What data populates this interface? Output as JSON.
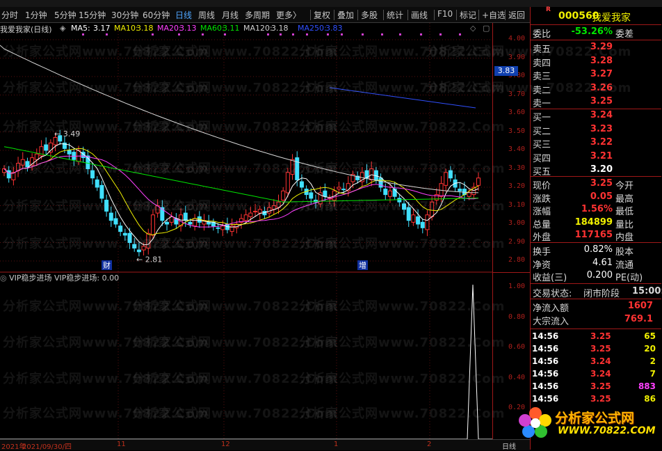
{
  "toolbar": {
    "left": [
      "分时",
      "1分钟",
      "5分钟",
      "15分钟",
      "30分钟",
      "60分钟",
      "日线",
      "周线",
      "月线",
      "多周期",
      "更多〉"
    ],
    "right": [
      "复权",
      "叠加",
      "多股",
      "统计",
      "画线",
      "F10",
      "标记",
      "+自选",
      "返回"
    ],
    "active": "日线"
  },
  "chart": {
    "stock_label": "我爱我家(日线)",
    "ma": [
      {
        "name": "MA5:",
        "value": "3.17",
        "color": "#ffffff"
      },
      {
        "name": "MA10:",
        "value": "3.18",
        "color": "#f0f000"
      },
      {
        "name": "MA20:",
        "value": "3.13",
        "color": "#ff40ff"
      },
      {
        "name": "MA60:",
        "value": "3.11",
        "color": "#00e600"
      },
      {
        "name": "MA120:",
        "value": "3.18",
        "color": "#d0d0d0"
      },
      {
        "name": "MA250:",
        "value": "3.83",
        "color": "#3050ff"
      }
    ],
    "y_labels": [
      "4.00",
      "3.90",
      "3.80",
      "3.70",
      "3.60",
      "3.50",
      "3.40",
      "3.30",
      "3.20",
      "3.10",
      "3.00",
      "2.90",
      "2.80"
    ],
    "current_price_tag": "3.83",
    "high_annotation": "3.49",
    "low_annotation": "2.81",
    "event_badges": [
      "财",
      "增"
    ],
    "up_color": "#ff3232",
    "down_color": "#40e0ff"
  },
  "indicator": {
    "header": "VIP稳步进场  VIP稳步进场: 0.00",
    "y_labels": [
      "1.00",
      "0.80",
      "0.60",
      "0.40",
      "0.20"
    ]
  },
  "bottom": {
    "date_labels": [
      "2021年",
      "2021/09/30/四",
      "11",
      "12",
      "1",
      "2",
      "日线"
    ]
  },
  "watermark": "分析家公式网www.70822.Com",
  "panel": {
    "code": "000560",
    "name": "我爱我家",
    "weibi_label": "委比",
    "weibi_value": "-53.26%",
    "weicha_label": "委差",
    "sell": [
      {
        "label": "卖五",
        "price": "3.29"
      },
      {
        "label": "卖四",
        "price": "3.28"
      },
      {
        "label": "卖三",
        "price": "3.27"
      },
      {
        "label": "卖二",
        "price": "3.26"
      },
      {
        "label": "卖一",
        "price": "3.25"
      }
    ],
    "buy": [
      {
        "label": "买一",
        "price": "3.24"
      },
      {
        "label": "买二",
        "price": "3.23"
      },
      {
        "label": "买三",
        "price": "3.22"
      },
      {
        "label": "买四",
        "price": "3.21"
      },
      {
        "label": "买五",
        "price": "3.20"
      }
    ],
    "quote": [
      {
        "l": "现价",
        "v": "3.25",
        "r": "今开",
        "c": "red"
      },
      {
        "l": "涨跌",
        "v": "0.05",
        "r": "最高",
        "c": "red"
      },
      {
        "l": "涨幅",
        "v": "1.56%",
        "r": "最低",
        "c": "red"
      },
      {
        "l": "总量",
        "v": "184899",
        "r": "量比",
        "c": "yellow"
      },
      {
        "l": "外盘",
        "v": "117165",
        "r": "内盘",
        "c": "red"
      }
    ],
    "fin": [
      {
        "l": "换手",
        "v": "0.82%",
        "r": "股本"
      },
      {
        "l": "净资",
        "v": "4.61",
        "r": "流通"
      },
      {
        "l": "收益(三)",
        "v": "0.200",
        "r": "PE(动)"
      }
    ],
    "status": {
      "label": "交易状态:",
      "value": "闭市阶段",
      "time": "15:00:"
    },
    "flow": [
      {
        "l": "净流入额",
        "v": "1607"
      },
      {
        "l": "大宗流入",
        "v": "769.1"
      }
    ],
    "ticks": [
      {
        "t": "14:56",
        "p": "3.25",
        "v": "65",
        "pc": "red",
        "vc": "yellow"
      },
      {
        "t": "14:56",
        "p": "3.25",
        "v": "20",
        "pc": "red",
        "vc": "yellow"
      },
      {
        "t": "14:56",
        "p": "3.24",
        "v": "2",
        "pc": "red",
        "vc": "yellow"
      },
      {
        "t": "14:56",
        "p": "3.24",
        "v": "7",
        "pc": "red",
        "vc": "yellow"
      },
      {
        "t": "14:56",
        "p": "3.25",
        "v": "883",
        "pc": "red",
        "vc": "magenta"
      },
      {
        "t": "14:56",
        "p": "3.25",
        "v": "86",
        "pc": "red",
        "vc": "yellow"
      }
    ]
  },
  "logo": {
    "text": "分析家公式网",
    "url": "WWW.70822.COM"
  }
}
